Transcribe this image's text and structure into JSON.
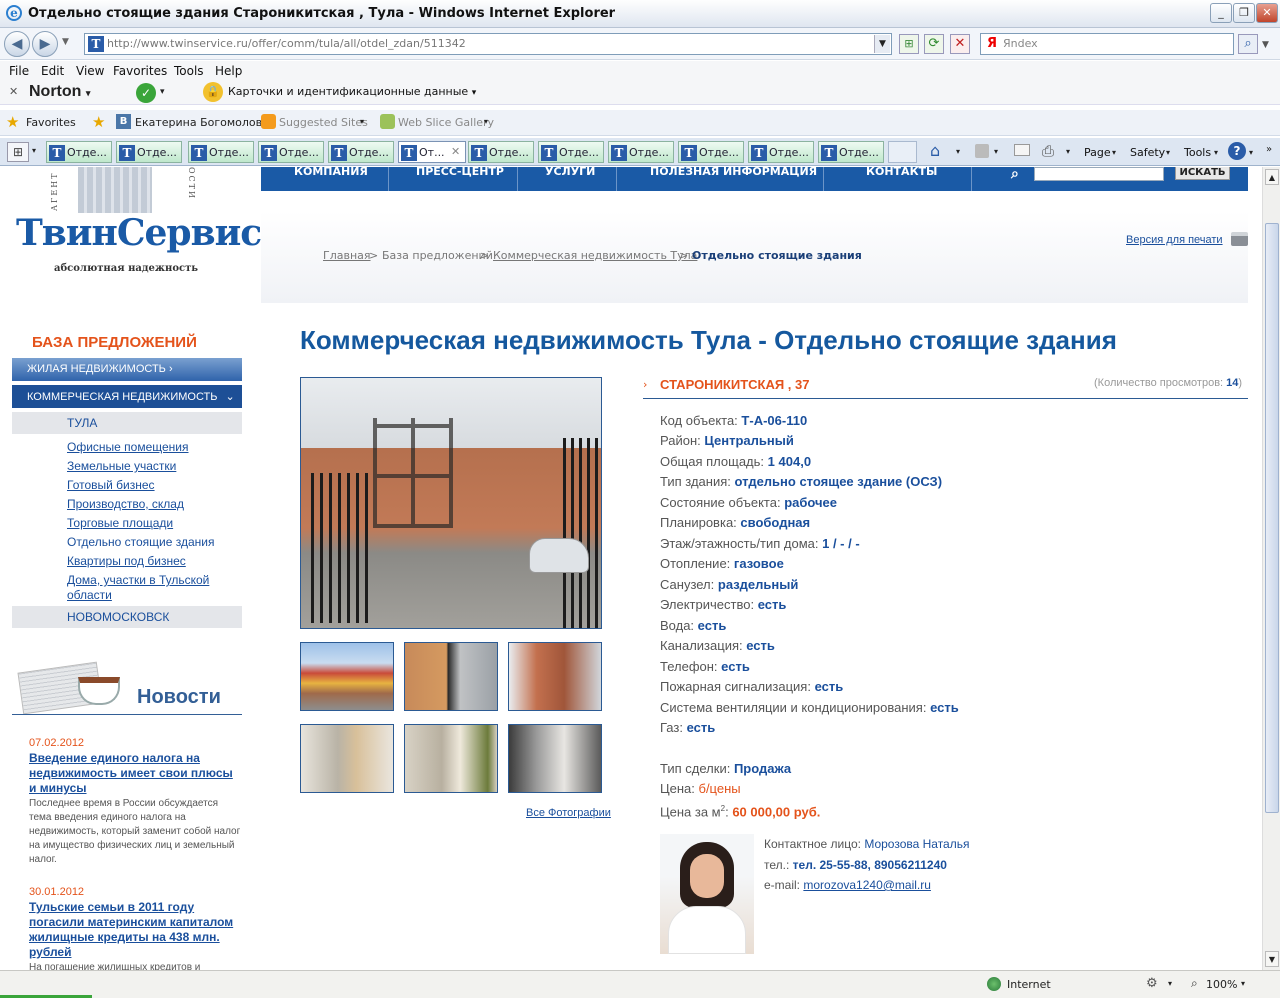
{
  "window": {
    "title": "Отдельно стоящие здания Староникитская , Тула - Windows Internet Explorer"
  },
  "address_bar": {
    "url": "http://www.twinservice.ru/offer/comm/tula/all/otdel_zdan/511342",
    "search_placeholder": "Яndex"
  },
  "menu": [
    "File",
    "Edit",
    "View",
    "Favorites",
    "Tools",
    "Help"
  ],
  "toolbar": {
    "norton": "Norton",
    "identity": "Карточки и идентификационные данные"
  },
  "favorites_bar": {
    "favorites": "Favorites",
    "items": [
      "Екатерина Богомолова",
      "Suggested Sites",
      "Web Slice Gallery"
    ]
  },
  "tabs": {
    "labels": [
      "Отде...",
      "Отде...",
      "Отде...",
      "Отде...",
      "Отде...",
      "От...",
      "Отде...",
      "Отде...",
      "Отде...",
      "Отде...",
      "Отде...",
      "Отде..."
    ]
  },
  "command_bar": {
    "page": "Page",
    "safety": "Safety",
    "tools": "Tools"
  },
  "site": {
    "nav": [
      "КОМПАНИЯ",
      "ПРЕСС-ЦЕНТР",
      "УСЛУГИ",
      "ПОЛЕЗНАЯ ИНФОРМАЦИЯ",
      "КОНТАКТЫ"
    ],
    "search_button": "ИСКАТЬ",
    "logo": {
      "name": "ТвинСервис",
      "slogan": "абсолютная надежность"
    },
    "print_link": "Версия для печати",
    "breadcrumb": [
      "Главная",
      "База предложений",
      "Коммерческая недвижимость Тула",
      "Отдельно стоящие здания"
    ],
    "page_title": "Коммерческая недвижимость Тула - Отдельно стоящие здания"
  },
  "sidebar": {
    "title": "БАЗА ПРЕДЛОЖЕНИЙ",
    "residential": "ЖИЛАЯ НЕДВИЖИМОСТЬ",
    "commercial": "КОММЕРЧЕСКАЯ НЕДВИЖИМОСТЬ",
    "city1": "ТУЛА",
    "subitems": [
      "Офисные помещения",
      "Земельные участки",
      "Готовый бизнес",
      "Производство, склад",
      "Торговые площади",
      "Отдельно стоящие здания",
      "Квартиры под бизнес",
      "Дома, участки в Тульской области"
    ],
    "city2": "НОВОМОСКОВСК",
    "news_title": "Новости",
    "news": [
      {
        "date": "07.02.2012",
        "title": "Введение единого налога на недвижимость имеет свои плюсы и минусы",
        "text": "Последнее время в России обсуждается тема введения единого налога на недвижимость, который заменит собой налог на имущество физических лиц и земельный налог."
      },
      {
        "date": "30.01.2012",
        "title": "Тульские семьи в 2011 году погасили материнским капиталом жилищные кредиты на 438 млн. рублей",
        "text": "На погашение жилищных кредитов и"
      }
    ]
  },
  "listing": {
    "address": "СТАРОНИКИТСКАЯ , 37",
    "views_label": "(Количество просмотров: ",
    "views_count": "14",
    "views_close": ")",
    "all_photos": "Все Фотографии",
    "props": [
      {
        "label": "Код объекта:",
        "value": "Т-А-06-110"
      },
      {
        "label": "Район:",
        "value": "Центральный"
      },
      {
        "label": "Общая площадь:",
        "value": "1 404,0"
      },
      {
        "label": "Тип здания:",
        "value": "отдельно стоящее здание (ОСЗ)"
      },
      {
        "label": "Состояние объекта:",
        "value": "рабочее"
      },
      {
        "label": "Планировка:",
        "value": "свободная"
      },
      {
        "label": "Этаж/этажность/тип дома:",
        "value": "1 / - / -"
      },
      {
        "label": "Отопление:",
        "value": "газовое"
      },
      {
        "label": "Санузел:",
        "value": "раздельный"
      },
      {
        "label": "Электричество:",
        "value": "есть"
      },
      {
        "label": "Вода:",
        "value": "есть"
      },
      {
        "label": "Канализация:",
        "value": "есть"
      },
      {
        "label": "Телефон:",
        "value": "есть"
      },
      {
        "label": "Пожарная сигнализация:",
        "value": "есть"
      },
      {
        "label": "Система вентиляции и кондиционирования:",
        "value": "есть"
      },
      {
        "label": "Газ:",
        "value": "есть"
      }
    ],
    "deal": {
      "label": "Тип сделки:",
      "value": "Продажа"
    },
    "price": {
      "label": "Цена:",
      "value": "б/цены"
    },
    "price_m2": {
      "label": "Цена за м",
      "sup": "2",
      "colon": ":",
      "value": "60 000,00 руб."
    },
    "contact": {
      "label": "Контактное лицо:",
      "name": "Морозова Наталья",
      "phone_label": "тел.:",
      "phone": "тел. 25-55-88, 89056211240",
      "email_label": "e-mail:",
      "email": "morozova1240@mail.ru"
    }
  },
  "status": {
    "zone": "Internet",
    "zoom": "100%"
  }
}
